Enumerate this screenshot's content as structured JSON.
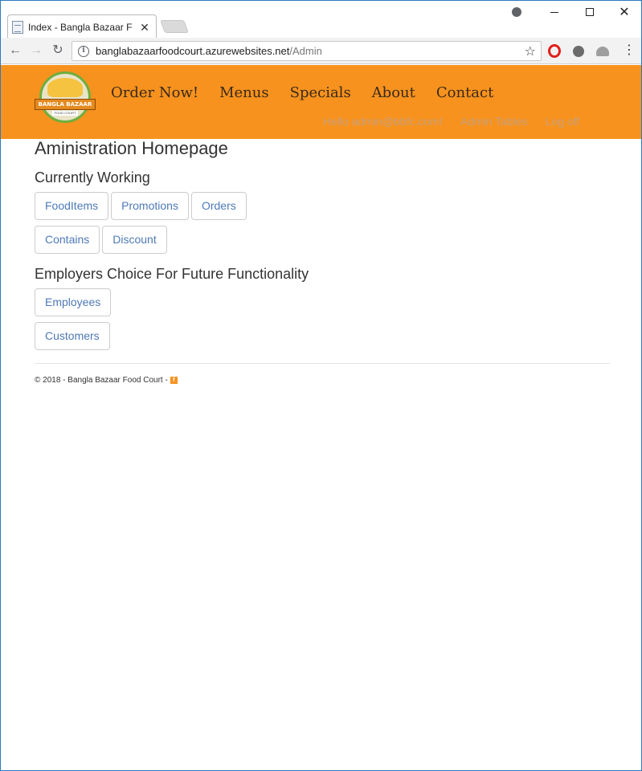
{
  "browser": {
    "tab_title": "Index - Bangla Bazaar Fo",
    "tab_close": "✕",
    "window_close": "✕",
    "url_host": "banglabazaarfoodcourt.azurewebsites.net",
    "url_path": "/Admin",
    "info_glyph": "i",
    "star_glyph": "☆",
    "menu_glyph": "⋮"
  },
  "site": {
    "logo_text": "BANGLA BAZAAR",
    "logo_subtext": "FOOD COURT",
    "nav": [
      "Order Now!",
      "Menus",
      "Specials",
      "About",
      "Contact"
    ],
    "user_nav": [
      "Hello admin@bbfc.com!",
      "Admin Tables",
      "Log off"
    ],
    "header_color": "#f7921e"
  },
  "main": {
    "title": "Aministration Homepage",
    "section_current": "Currently Working",
    "current_buttons_row1": [
      "FoodItems",
      "Promotions",
      "Orders"
    ],
    "current_buttons_row2": [
      "Contains",
      "Discount"
    ],
    "section_future": "Employers Choice For Future Functionality",
    "future_buttons": [
      "Employees",
      "Customers"
    ]
  },
  "footer": {
    "text": "© 2018 - Bangla Bazaar Food Court -",
    "fb_glyph": "f"
  }
}
